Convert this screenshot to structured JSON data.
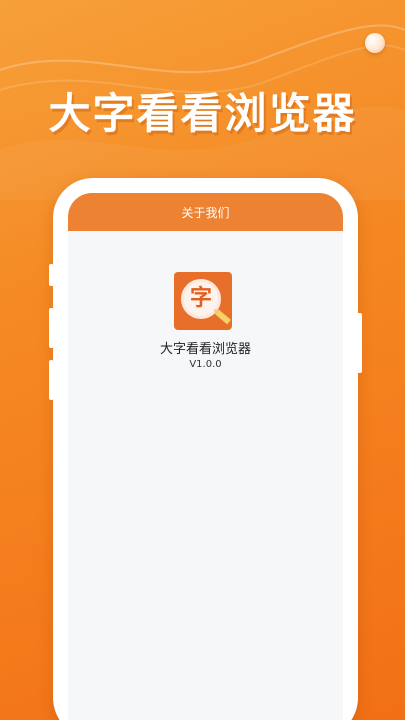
{
  "promo": {
    "title": "大字看看浏览器"
  },
  "screen": {
    "header_title": "关于我们",
    "app_name": "大字看看浏览器",
    "version": "V1.0.0",
    "logo_char": "字"
  },
  "colors": {
    "background": "#f58a24",
    "header": "#ed8232",
    "logo_bg": "#e86f2a",
    "screen_bg": "#f6f7f9"
  }
}
